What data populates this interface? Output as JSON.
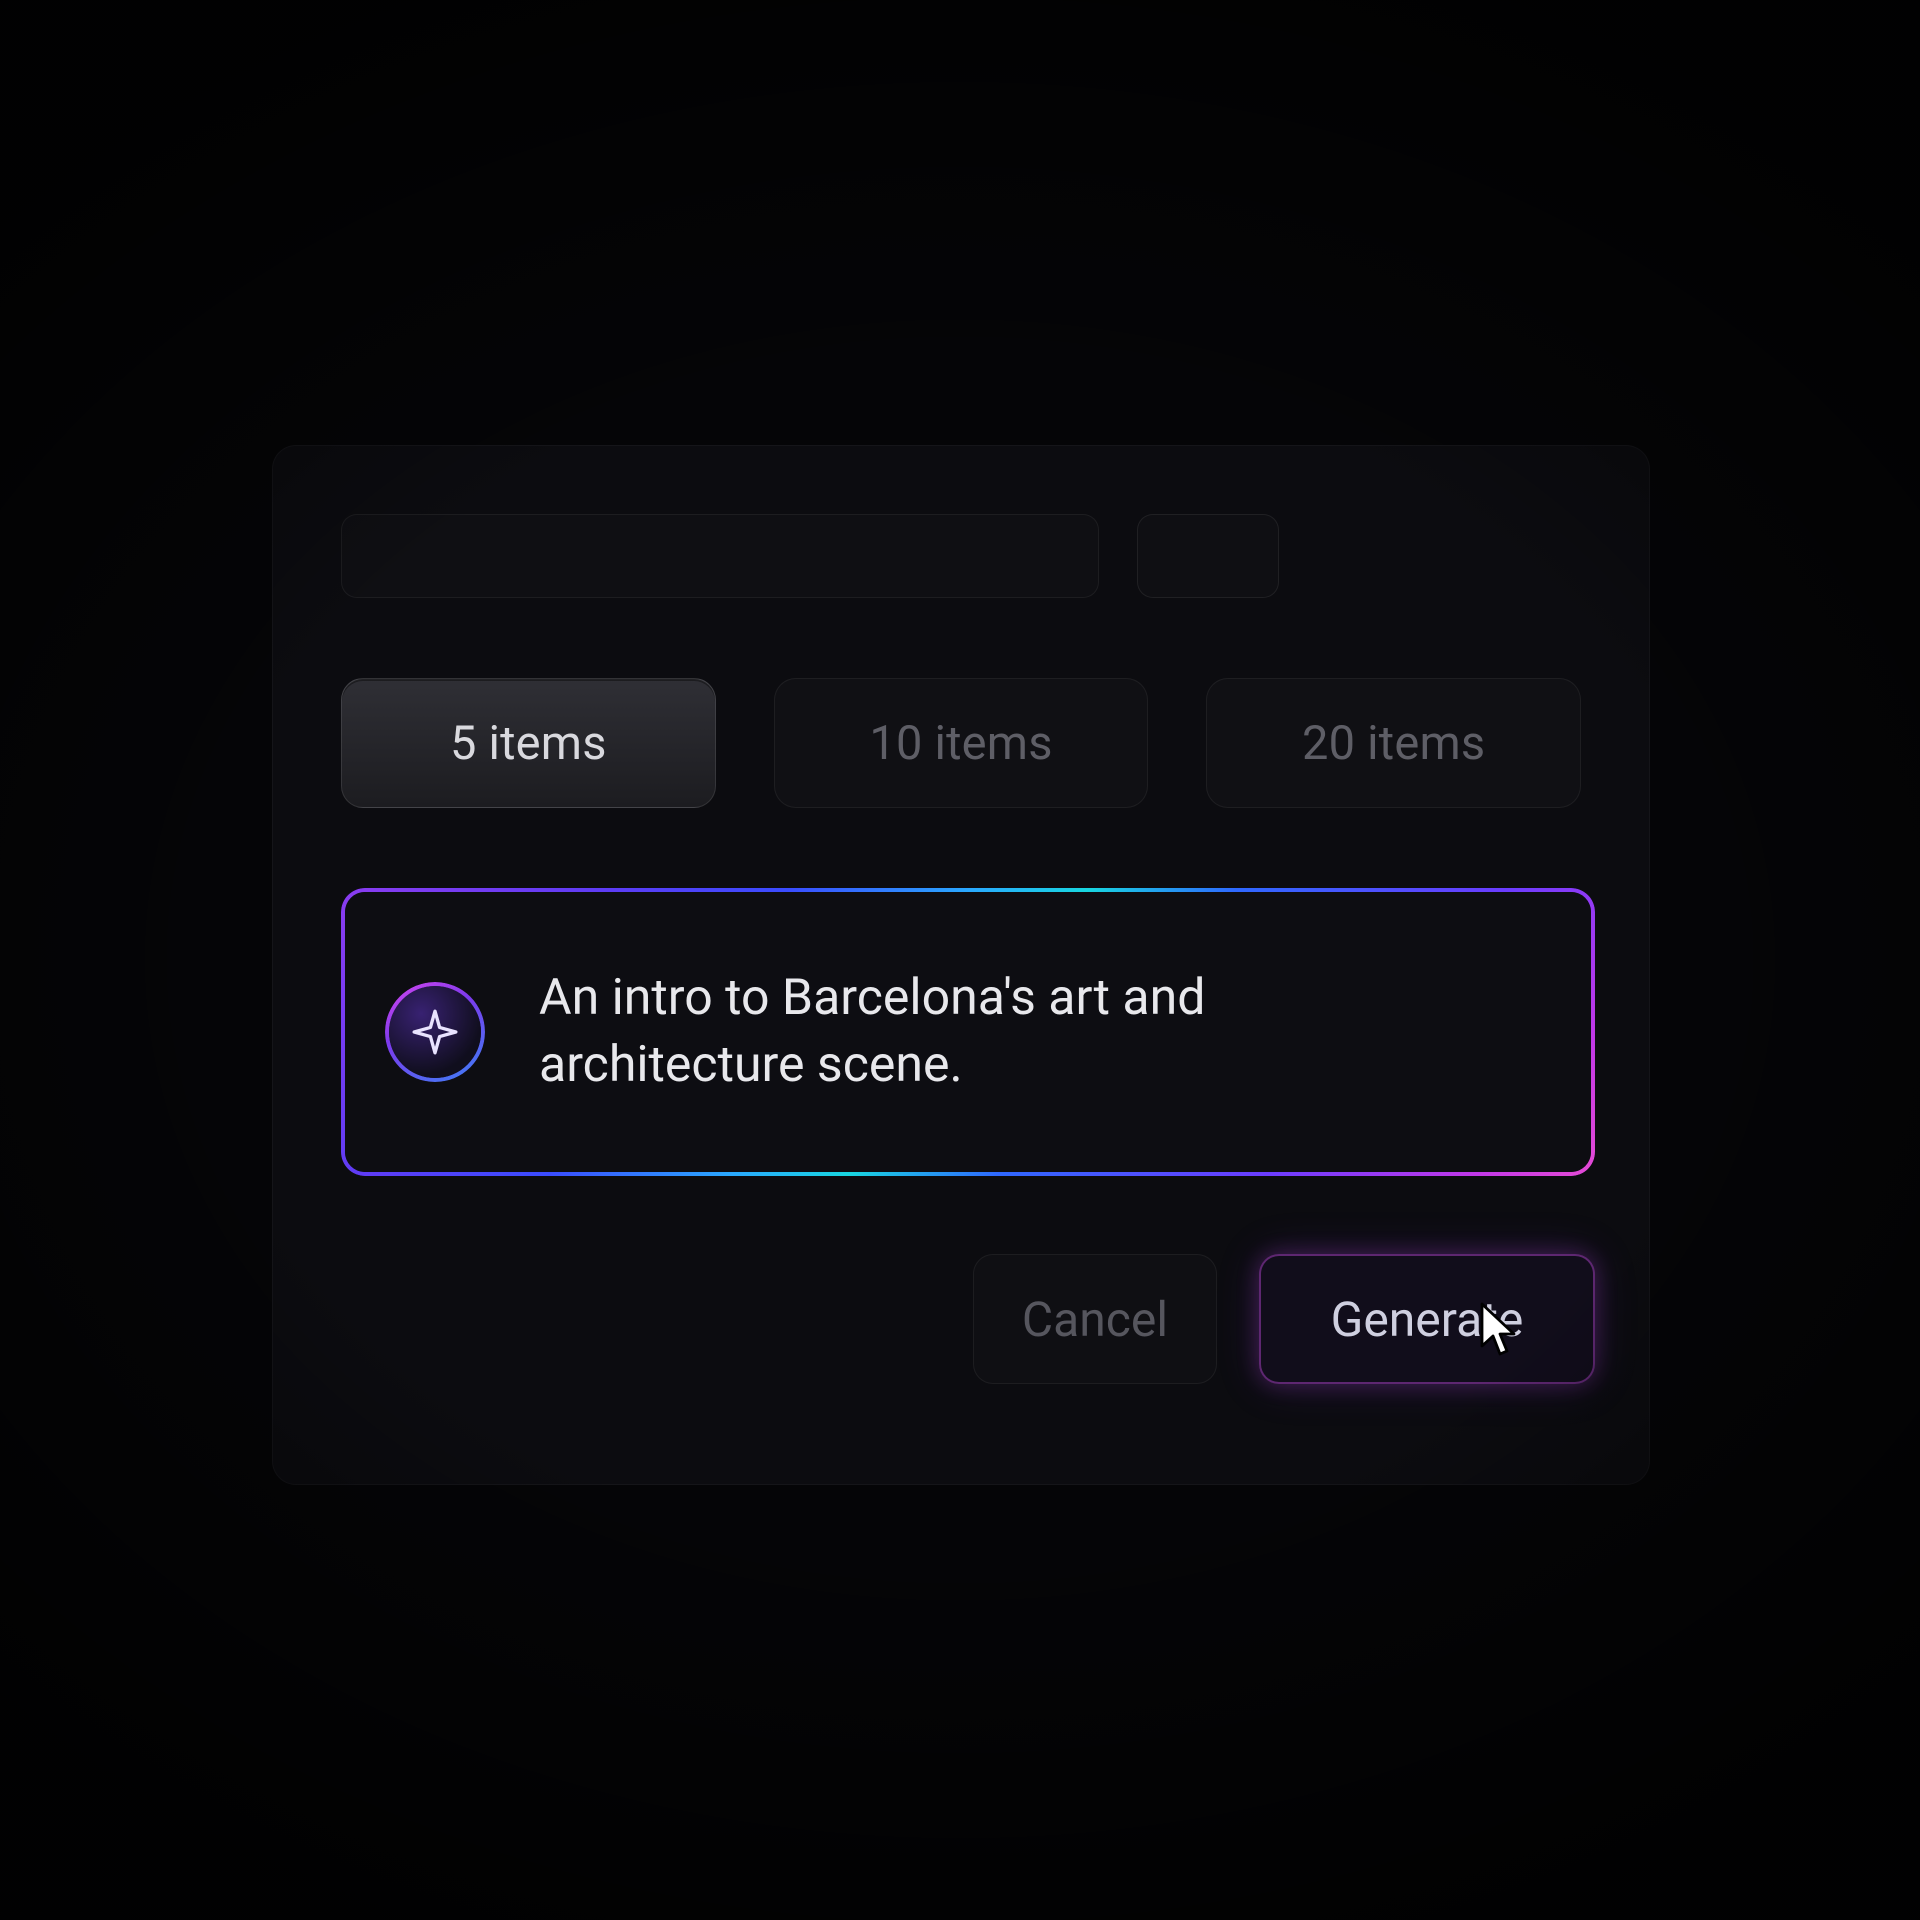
{
  "chips": {
    "options": [
      "5 items",
      "10 items",
      "20 items"
    ],
    "selected_index": 0
  },
  "prompt": {
    "text": "An intro to Barcelona's art and architecture scene.",
    "icon": "sparkle-icon"
  },
  "actions": {
    "cancel_label": "Cancel",
    "generate_label": "Generate"
  },
  "colors": {
    "accent_purple": "#8a3cf0",
    "accent_blue": "#3a4cff",
    "accent_cyan": "#18d6e0",
    "accent_magenta": "#e64bd4"
  }
}
